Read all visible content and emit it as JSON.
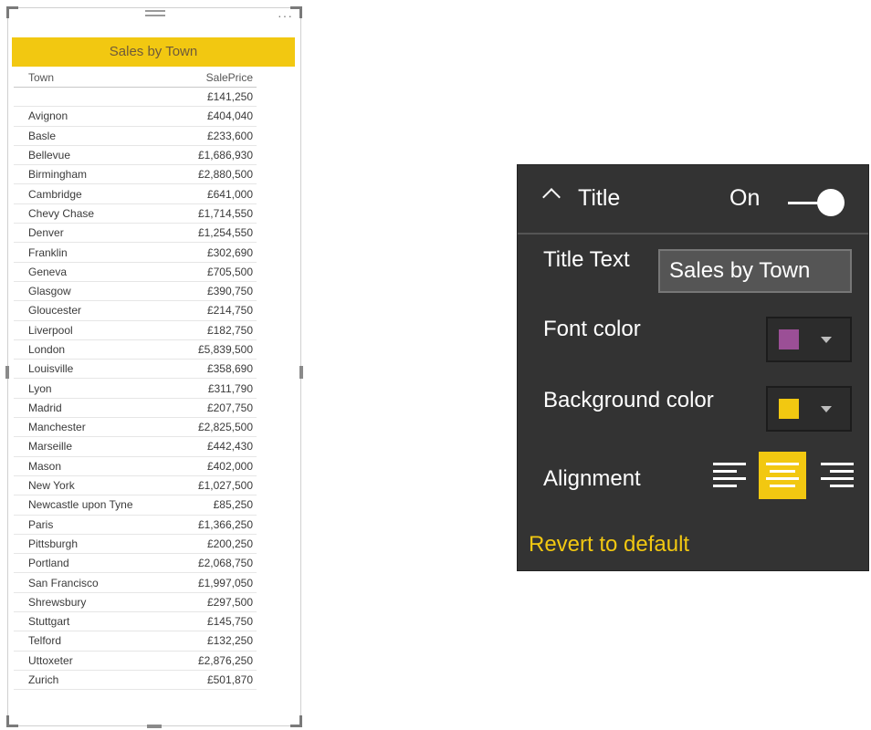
{
  "table_visual": {
    "title": "Sales by Town",
    "title_bg": "#f2c811",
    "columns": [
      "Town",
      "SalePrice"
    ],
    "rows": [
      {
        "town": "",
        "price": "£141,250"
      },
      {
        "town": "Avignon",
        "price": "£404,040"
      },
      {
        "town": "Basle",
        "price": "£233,600"
      },
      {
        "town": "Bellevue",
        "price": "£1,686,930"
      },
      {
        "town": "Birmingham",
        "price": "£2,880,500"
      },
      {
        "town": "Cambridge",
        "price": "£641,000"
      },
      {
        "town": "Chevy Chase",
        "price": "£1,714,550"
      },
      {
        "town": "Denver",
        "price": "£1,254,550"
      },
      {
        "town": "Franklin",
        "price": "£302,690"
      },
      {
        "town": "Geneva",
        "price": "£705,500"
      },
      {
        "town": "Glasgow",
        "price": "£390,750"
      },
      {
        "town": "Gloucester",
        "price": "£214,750"
      },
      {
        "town": "Liverpool",
        "price": "£182,750"
      },
      {
        "town": "London",
        "price": "£5,839,500"
      },
      {
        "town": "Louisville",
        "price": "£358,690"
      },
      {
        "town": "Lyon",
        "price": "£311,790"
      },
      {
        "town": "Madrid",
        "price": "£207,750"
      },
      {
        "town": "Manchester",
        "price": "£2,825,500"
      },
      {
        "town": "Marseille",
        "price": "£442,430"
      },
      {
        "town": "Mason",
        "price": "£402,000"
      },
      {
        "town": "New York",
        "price": "£1,027,500"
      },
      {
        "town": "Newcastle upon Tyne",
        "price": "£85,250"
      },
      {
        "town": "Paris",
        "price": "£1,366,250"
      },
      {
        "town": "Pittsburgh",
        "price": "£200,250"
      },
      {
        "town": "Portland",
        "price": "£2,068,750"
      },
      {
        "town": "San Francisco",
        "price": "£1,997,050"
      },
      {
        "town": "Shrewsbury",
        "price": "£297,500"
      },
      {
        "town": "Stuttgart",
        "price": "£145,750"
      },
      {
        "town": "Telford",
        "price": "£132,250"
      },
      {
        "town": "Uttoxeter",
        "price": "£2,876,250"
      },
      {
        "town": "Zurich",
        "price": "£501,870"
      }
    ]
  },
  "format_panel": {
    "section_title": "Title",
    "toggle_label": "On",
    "toggle_state": true,
    "title_text_label": "Title Text",
    "title_text_value": "Sales by Town",
    "font_color_label": "Font color",
    "font_color": "#9b4f96",
    "background_color_label": "Background color",
    "background_color": "#f2c811",
    "alignment_label": "Alignment",
    "alignment_options": [
      "left",
      "center",
      "right"
    ],
    "alignment_selected": "center",
    "revert_label": "Revert to default"
  }
}
